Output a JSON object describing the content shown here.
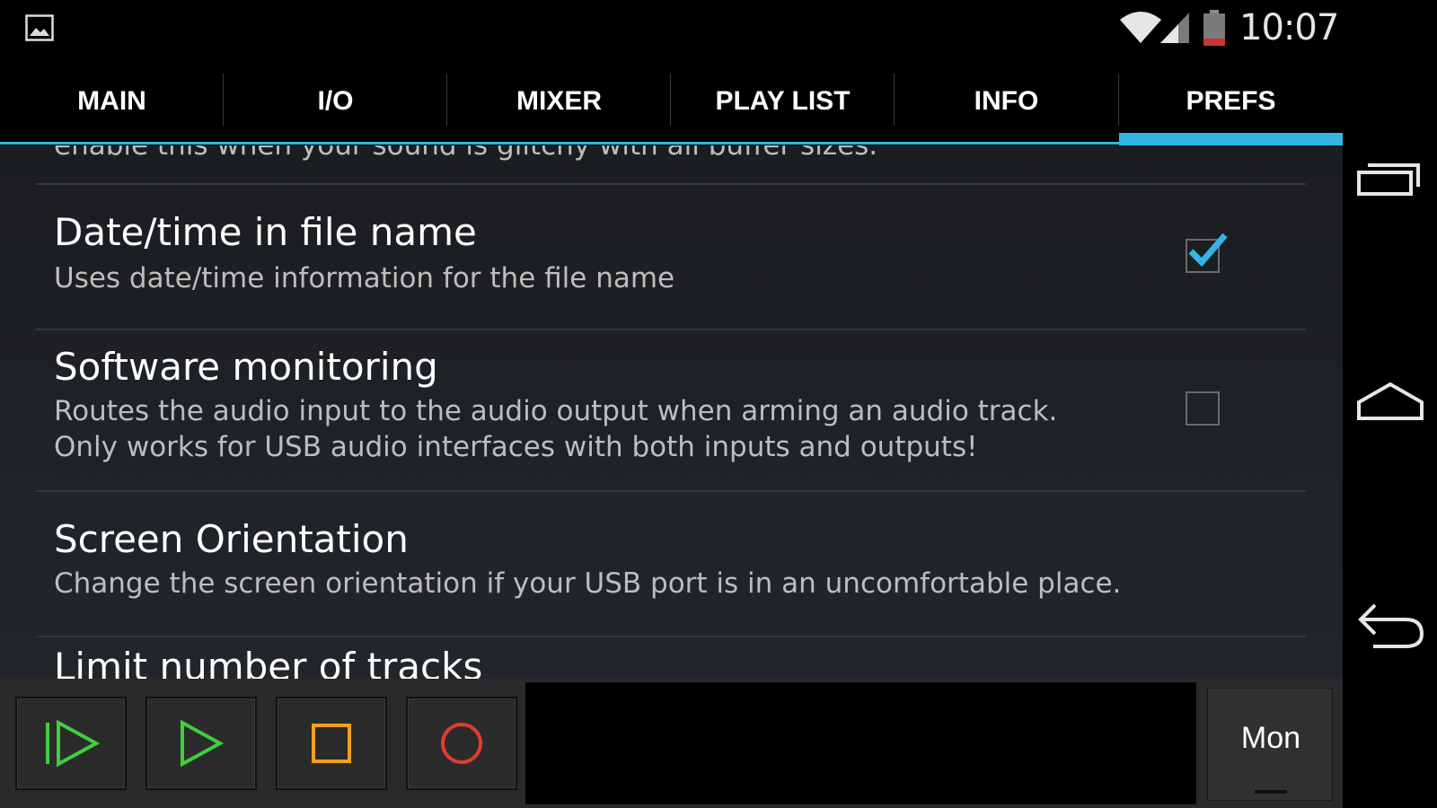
{
  "status_bar": {
    "time": "10:07",
    "left_icon": "image-icon",
    "icons": [
      "wifi-icon",
      "signal-icon",
      "battery-icon"
    ]
  },
  "tabs": [
    {
      "label": "MAIN"
    },
    {
      "label": "I/O"
    },
    {
      "label": "MIXER"
    },
    {
      "label": "PLAY LIST"
    },
    {
      "label": "INFO"
    },
    {
      "label": "PREFS",
      "active": true
    }
  ],
  "preferences": {
    "partial_summary": "enable this when your sound is glitchy with all buffer sizes.",
    "items": [
      {
        "title": "Date/time in file name",
        "summary": "Uses date/time information for the file name",
        "checked": true
      },
      {
        "title": "Software monitoring",
        "summary_line1": "Routes the audio input to the audio output when arming an audio track.",
        "summary_line2": "Only works for USB audio interfaces with both inputs and outputs!",
        "checked": false
      },
      {
        "title": "Screen Orientation",
        "summary": "Change the screen orientation if your USB port is in an uncomfortable place."
      },
      {
        "title": "Limit number of tracks"
      }
    ]
  },
  "transport": {
    "buttons": [
      "play-from-start-icon",
      "play-icon",
      "stop-icon",
      "record-icon"
    ],
    "mon_label": "Mon",
    "colors": {
      "play": "#3fcf3f",
      "stop": "#f0a020",
      "record": "#e23b30"
    }
  },
  "nav_bar": {
    "buttons": [
      "recent-apps-icon",
      "home-icon",
      "back-icon"
    ]
  },
  "colors": {
    "accent": "#33b5e5",
    "background": "#1e2124"
  }
}
